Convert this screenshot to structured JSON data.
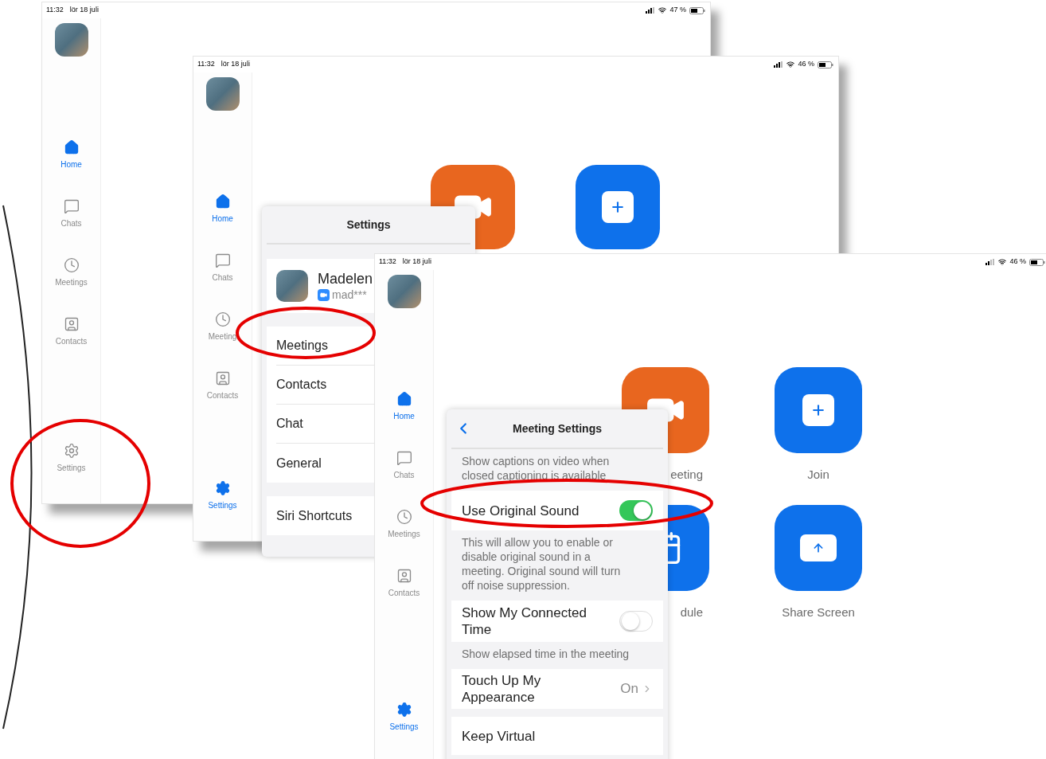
{
  "screens": [
    {
      "status": {
        "time": "11:32",
        "date": "lör 18 juli",
        "battery": "47 %"
      },
      "sidebar": [
        {
          "kind": "home",
          "label": "Home",
          "selected": true
        },
        {
          "kind": "chats",
          "label": "Chats",
          "selected": false
        },
        {
          "kind": "meetings",
          "label": "Meetings",
          "selected": false
        },
        {
          "kind": "contacts",
          "label": "Contacts",
          "selected": false
        },
        {
          "kind": "settings",
          "label": "Settings",
          "selected": false
        }
      ]
    },
    {
      "status": {
        "time": "11:32",
        "date": "lör 18 juli",
        "battery": "46 %"
      },
      "sidebar": [
        {
          "kind": "home",
          "label": "Home",
          "selected": true
        },
        {
          "kind": "chats",
          "label": "Chats",
          "selected": false
        },
        {
          "kind": "meetings",
          "label": "Meeting",
          "selected": false
        },
        {
          "kind": "contacts",
          "label": "Contacts",
          "selected": false
        },
        {
          "kind": "settings",
          "label": "Settings",
          "selected": true
        }
      ],
      "tiles": [
        {
          "kind": "video",
          "color": "#e8661f"
        },
        {
          "kind": "join",
          "color": "#0e71eb"
        }
      ],
      "settings_menu": {
        "title": "Settings",
        "profile": {
          "name": "Madelen",
          "account": "mad***"
        },
        "groups": [
          [
            "Meetings",
            "Contacts",
            "Chat",
            "General"
          ],
          [
            "Siri Shortcuts"
          ]
        ]
      }
    },
    {
      "status": {
        "time": "11:32",
        "date": "lör 18 juli",
        "battery": "46 %"
      },
      "sidebar": [
        {
          "kind": "home",
          "label": "Home",
          "selected": true
        },
        {
          "kind": "chats",
          "label": "Chats",
          "selected": false
        },
        {
          "kind": "meetings",
          "label": "Meetings",
          "selected": false
        },
        {
          "kind": "contacts",
          "label": "Contacts",
          "selected": false
        },
        {
          "kind": "settings",
          "label": "Settings",
          "selected": true
        }
      ],
      "tiles": [
        {
          "kind": "video",
          "color": "#e8661f",
          "label": "eeting"
        },
        {
          "kind": "join",
          "color": "#0e71eb",
          "label": "Join"
        },
        {
          "kind": "schedule",
          "color": "#0e71eb",
          "label": "dule"
        },
        {
          "kind": "share",
          "color": "#0e71eb",
          "label": "Share Screen"
        }
      ],
      "meeting_settings": {
        "title": "Meeting Settings",
        "rows": [
          {
            "kind": "note",
            "text": "Show captions on video when closed captioning is available"
          },
          {
            "kind": "toggle",
            "label": "Use Original Sound",
            "on": true
          },
          {
            "kind": "note",
            "text": "This will allow you to enable or disable original sound in a meeting. Original sound will turn off noise suppression."
          },
          {
            "kind": "toggle",
            "label": "Show My Connected Time",
            "on": false
          },
          {
            "kind": "note",
            "text": "Show elapsed time in the meeting"
          },
          {
            "kind": "link",
            "label": "Touch Up My Appearance",
            "value": "On"
          },
          {
            "kind": "link",
            "label": "Keep Virtual"
          }
        ]
      }
    }
  ]
}
